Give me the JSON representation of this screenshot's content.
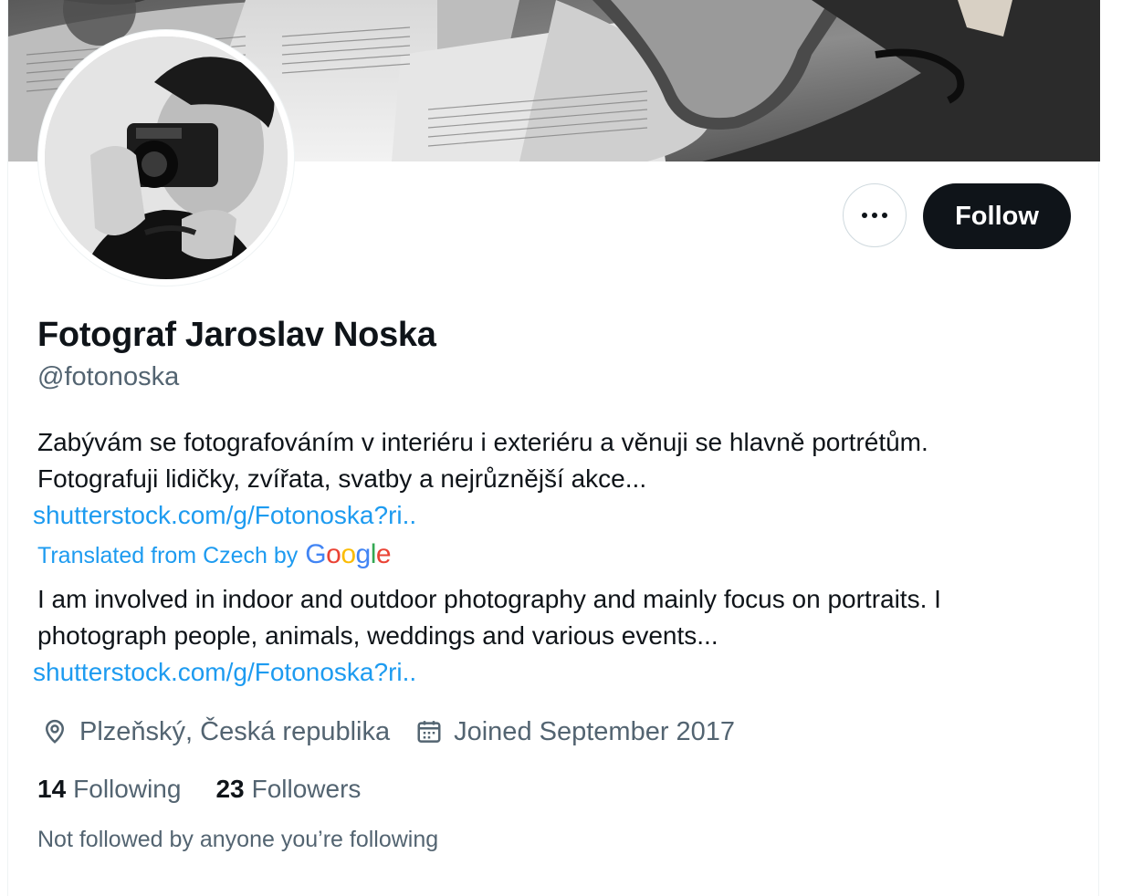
{
  "profile": {
    "display_name": "Fotograf Jaroslav Noska",
    "handle": "@fotonoska",
    "bio_original_line1": "Zabývám se fotografováním v interiéru i exteriéru a věnuji se hlavně portrétům.",
    "bio_original_line2": "Fotografuji lidičky, zvířata, svatby a nejrůznější akce...",
    "bio_link": "shutterstock.com/g/Fotonoska?ri..",
    "translated_label": "Translated from Czech by",
    "translation_provider": "Google",
    "bio_translated": "I am involved in indoor and outdoor photography and mainly focus on portraits. I photograph people, animals, weddings and various events...",
    "bio_translated_link": "shutterstock.com/g/Fotonoska?ri..",
    "location": "Plzeňský, Česká republika",
    "joined": "Joined September 2017",
    "following_count": "14",
    "following_label": "Following",
    "followers_count": "23",
    "followers_label": "Followers",
    "not_followed_text": "Not followed by anyone you’re following"
  },
  "actions": {
    "follow_label": "Follow",
    "more_icon": "more-horizontal-icon"
  },
  "icons": {
    "location": "location-pin-icon",
    "calendar": "calendar-icon"
  },
  "colors": {
    "link": "#1d9bf0",
    "secondary_text": "#536471",
    "primary_text": "#0f1419",
    "follow_button_bg": "#0f1419"
  }
}
